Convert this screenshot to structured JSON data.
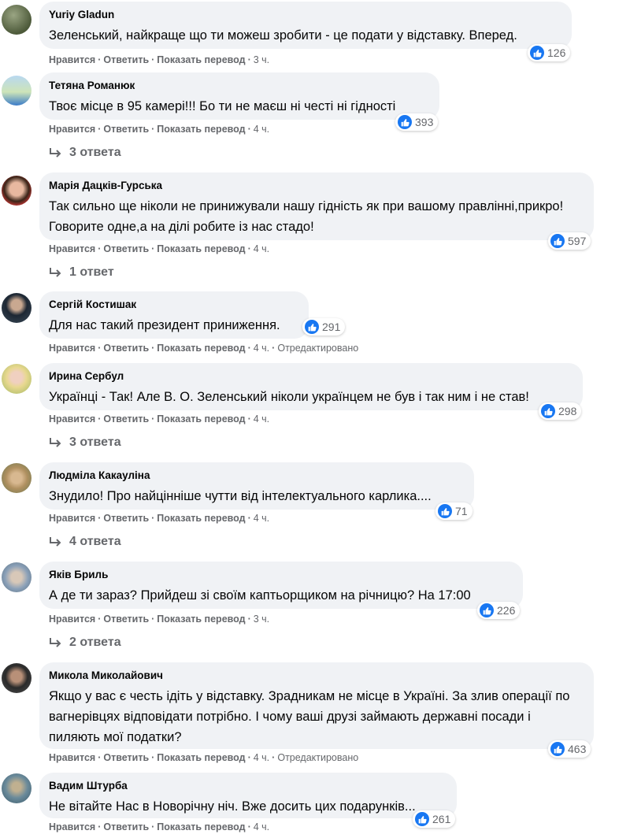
{
  "actions": {
    "like": "Нравится",
    "reply": "Ответить",
    "translate": "Показать перевод",
    "edited": "Отредактировано",
    "separator": "·"
  },
  "comments": [
    {
      "author": "Yuriy Gladun",
      "text": "Зеленський, найкраще що ти можеш зробити - це подати у відставку. Вперед.",
      "reactions": "126",
      "time": "3 ч.",
      "replies": ""
    },
    {
      "author": "Тетяна Романюк",
      "text": "Твоє місце в 95 камері!!! Бо ти не маєш ні честі ні гідності",
      "reactions": "393",
      "time": "4 ч.",
      "replies": "3 ответа"
    },
    {
      "author": "Марія Дацків-Гурська",
      "text": "Так сильно ще ніколи не принижували нашу гідність як при вашому правлінні,прикро! Говорите одне,а на ділі робите із нас стадо!",
      "reactions": "597",
      "time": "4 ч.",
      "replies": "1 ответ"
    },
    {
      "author": "Сергій Костишак",
      "text": "Для нас такий президент приниження.",
      "reactions": "291",
      "time": "4 ч.",
      "edited": true,
      "replies": ""
    },
    {
      "author": "Ирина Сербул",
      "text": "Українці - Так! Але В. О. Зеленський ніколи українцем не був і так ним і не став!",
      "reactions": "298",
      "time": "4 ч.",
      "replies": "3 ответа"
    },
    {
      "author": "Людміла Какауліна",
      "text": "Знудило! Про найцінніше чутти від інтелектуального карлика....",
      "reactions": "71",
      "time": "4 ч.",
      "replies": "4 ответа"
    },
    {
      "author": "Яків Бриль",
      "text": "А де ти зараз? Прийдеш зі своїм каптьорщиком на річницю? На 17:00",
      "reactions": "226",
      "time": "3 ч.",
      "replies": "2 ответа"
    },
    {
      "author": "Микола Миколайович",
      "text": "Якщо у вас є честь ідіть у відставку. Зрадникам не місце в Україні. За злив операції по вагнерівцях відповідати потрібно. І чому ваші друзі займають державні посади і пиляють мої податки?",
      "reactions": "463",
      "time": "4 ч.",
      "edited": true,
      "replies": ""
    },
    {
      "author": "Вадим Штурба",
      "text": "Не вітайте Нас в Новорічну ніч. Вже досить цих подарунків...",
      "reactions": "261",
      "time": "4 ч.",
      "replies": ""
    }
  ],
  "colors": {
    "bubble": "#f0f2f5",
    "like_blue": "#1877f2",
    "meta_gray": "#65676b"
  }
}
